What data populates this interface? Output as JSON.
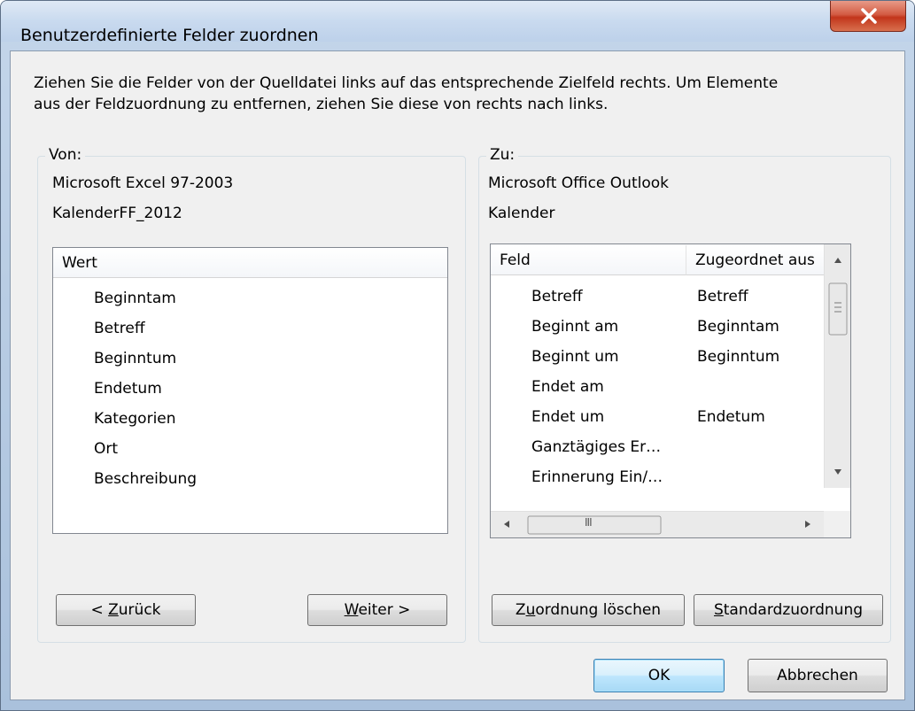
{
  "window": {
    "title": "Benutzerdefinierte Felder zuordnen"
  },
  "instructions": {
    "line1": "Ziehen Sie die Felder von der Quelldatei links auf das entsprechende Zielfeld rechts. Um Elemente",
    "line2": "aus der Feldzuordnung zu entfernen, ziehen Sie diese von rechts nach links."
  },
  "source": {
    "label": "Von:",
    "app": "Microsoft Excel 97-2003",
    "file": "KalenderFF_2012",
    "column_header": "Wert",
    "items": [
      "Beginntam",
      "Betreff",
      "Beginntum",
      "Endetum",
      "Kategorien",
      "Ort",
      "Beschreibung"
    ]
  },
  "target": {
    "label": "Zu:",
    "app": "Microsoft Office Outlook",
    "folder": "Kalender",
    "columns": [
      "Feld",
      "Zugeordnet aus"
    ],
    "rows": [
      {
        "field": "Betreff",
        "mapped": "Betreff"
      },
      {
        "field": "Beginnt am",
        "mapped": "Beginntam"
      },
      {
        "field": "Beginnt um",
        "mapped": "Beginntum"
      },
      {
        "field": "Endet am",
        "mapped": ""
      },
      {
        "field": "Endet um",
        "mapped": "Endetum"
      },
      {
        "field": "Ganztägiges Er…",
        "mapped": ""
      },
      {
        "field": "Erinnerung Ein/…",
        "mapped": ""
      }
    ],
    "hscroll_thumb_glyph": "III"
  },
  "buttons": {
    "back_prefix": "< ",
    "back_mnemonic": "Z",
    "back_rest": "urück",
    "next_mnemonic": "W",
    "next_rest": "eiter >",
    "clear_pre": "Z",
    "clear_mnemonic": "u",
    "clear_rest": "ordnung löschen",
    "default_mnemonic": "S",
    "default_rest": "tandardzuordnung",
    "ok": "OK",
    "cancel": "Abbrechen"
  },
  "colors": {
    "close_red": "#c2351b",
    "default_button_border": "#3c7fb1"
  }
}
